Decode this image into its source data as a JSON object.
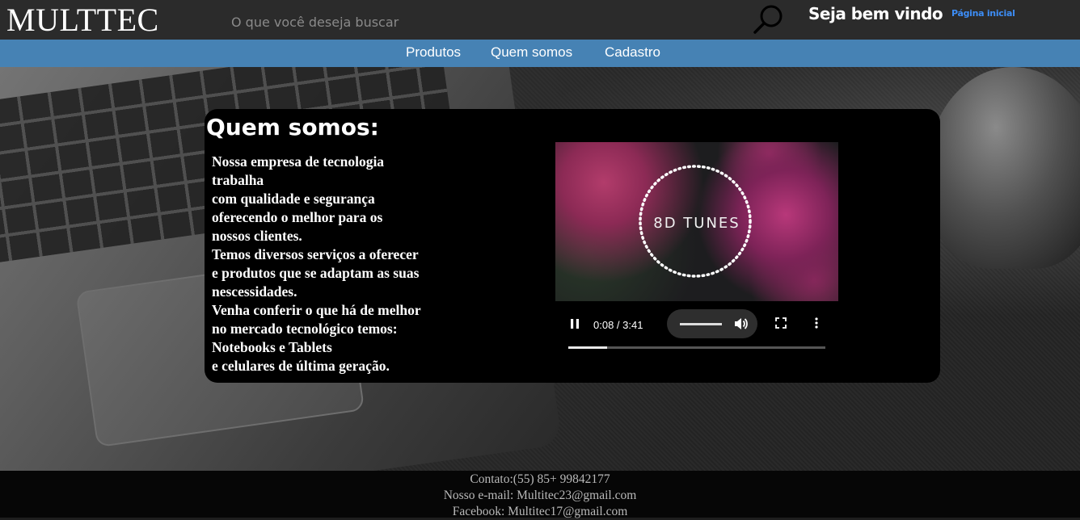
{
  "header": {
    "logo": "MULTTEC",
    "search_placeholder": "O que você deseja buscar",
    "welcome": "Seja bem vindo",
    "home_link": "Página inicial"
  },
  "nav": {
    "items": [
      "Produtos",
      "Quem somos",
      "Cadastro"
    ]
  },
  "about": {
    "title": "Quem somos:",
    "lines": [
      "Nossa empresa de tecnologia",
      "trabalha",
      "com qualidade e segurança",
      "oferecendo o melhor para os",
      "nossos clientes.",
      "Temos diversos serviços a oferecer",
      "e produtos que se adaptam as suas",
      "nescessidades.",
      "Venha conferir o que há de melhor",
      "no mercado tecnológico temos:",
      "Notebooks e Tablets",
      "e celulares de última geração."
    ]
  },
  "video": {
    "overlay_text": "8D TUNES",
    "time_display": "0:08 / 3:41",
    "progress": 0.15,
    "volume": 0.8,
    "icons": [
      "pause-icon",
      "volume-icon",
      "fullscreen-icon",
      "more-options-icon"
    ]
  },
  "footer": {
    "contact": "Contato:(55) 85+ 99842177",
    "email": "Nosso e-mail: Multitec23@gmail.com",
    "facebook": "Facebook: Multitec17@gmail.com"
  },
  "colors": {
    "topbar": "#2b2b2b",
    "navbar": "#4682b4",
    "link": "#3d8df5",
    "panel": "#000000",
    "footer": "#060606"
  }
}
